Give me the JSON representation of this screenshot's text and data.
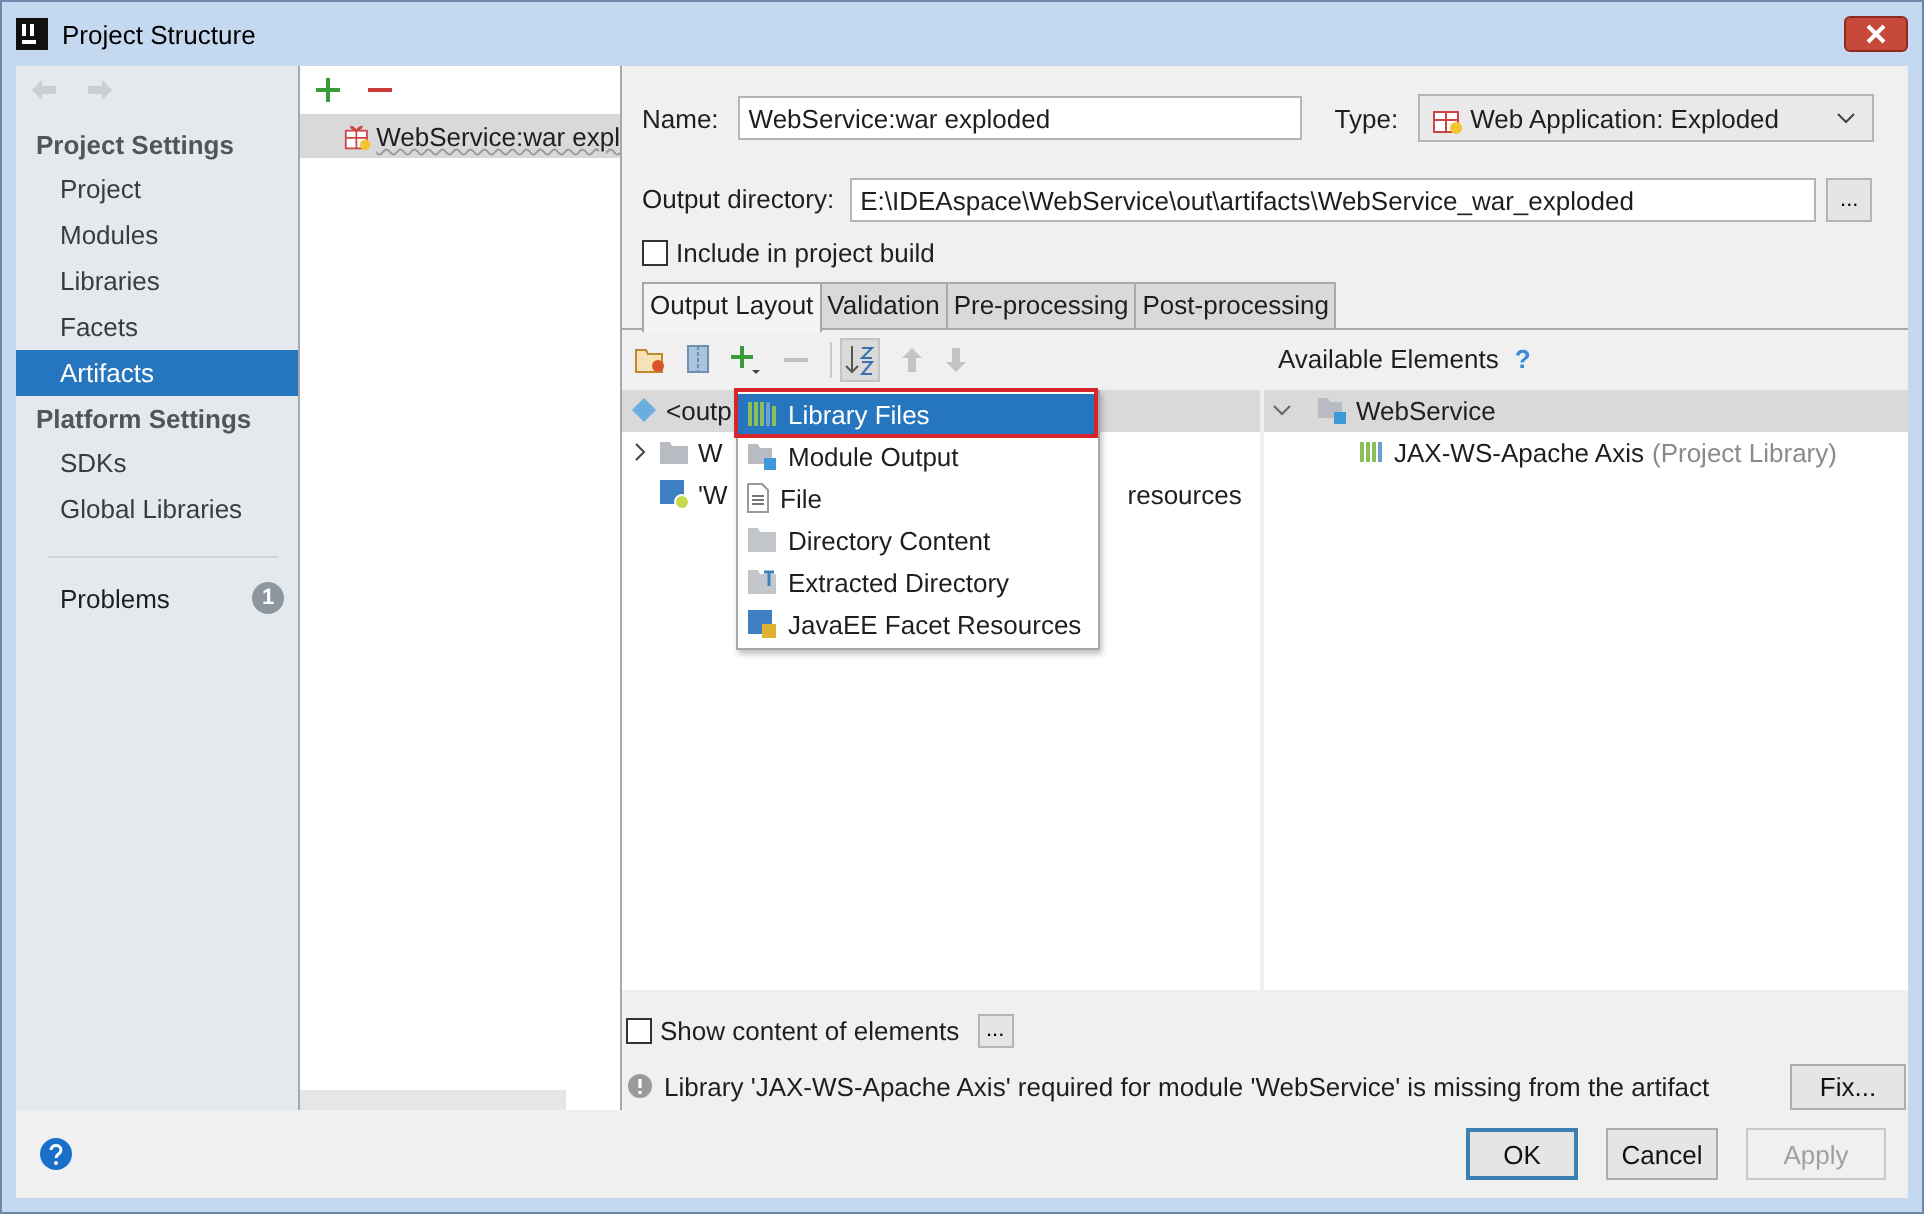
{
  "window": {
    "title": "Project Structure"
  },
  "sidebar": {
    "sections": [
      {
        "heading": "Project Settings",
        "items": [
          {
            "label": "Project",
            "selected": false
          },
          {
            "label": "Modules",
            "selected": false
          },
          {
            "label": "Libraries",
            "selected": false
          },
          {
            "label": "Facets",
            "selected": false
          },
          {
            "label": "Artifacts",
            "selected": true
          }
        ]
      },
      {
        "heading": "Platform Settings",
        "items": [
          {
            "label": "SDKs",
            "selected": false
          },
          {
            "label": "Global Libraries",
            "selected": false
          }
        ]
      }
    ],
    "problems": {
      "label": "Problems",
      "count": "1"
    }
  },
  "artifacts_list": {
    "items": [
      {
        "label": "WebService:war expl",
        "selected": true
      }
    ]
  },
  "name": {
    "label": "Name:",
    "value": "WebService:war exploded"
  },
  "type": {
    "label": "Type:",
    "value": "Web Application: Exploded"
  },
  "output_directory": {
    "label": "Output directory:",
    "value": "E:\\IDEAspace\\WebService\\out\\artifacts\\WebService_war_exploded"
  },
  "browse_button": "...",
  "include_in_build": {
    "label": "Include in project build",
    "checked": false
  },
  "tabs": [
    {
      "label": "Output Layout",
      "selected": true
    },
    {
      "label": "Validation",
      "selected": false
    },
    {
      "label": "Pre-processing",
      "selected": false
    },
    {
      "label": "Post-processing",
      "selected": false
    }
  ],
  "output_tree": {
    "rows": [
      {
        "kind": "root",
        "text": "<outp",
        "selected": true
      },
      {
        "kind": "folder",
        "text": "W",
        "selected": false
      },
      {
        "kind": "resources",
        "text": "'W",
        "trailing": "resources",
        "selected": false
      }
    ]
  },
  "add_menu": {
    "items": [
      {
        "kind": "library",
        "label": "Library Files",
        "selected": true,
        "marked": true
      },
      {
        "kind": "module",
        "label": "Module Output",
        "selected": false,
        "marked": false
      },
      {
        "kind": "file",
        "label": "File",
        "selected": false,
        "marked": false
      },
      {
        "kind": "directory",
        "label": "Directory Content",
        "selected": false,
        "marked": false
      },
      {
        "kind": "extracted",
        "label": "Extracted Directory",
        "selected": false,
        "marked": false
      },
      {
        "kind": "facet",
        "label": "JavaEE Facet Resources",
        "selected": false,
        "marked": false
      }
    ]
  },
  "available_elements": {
    "title": "Available Elements",
    "help": "?",
    "tree": [
      {
        "label": "WebService",
        "expanded": true,
        "selected": true,
        "children": [
          {
            "label": "JAX-WS-Apache Axis",
            "note": "(Project Library)"
          }
        ]
      }
    ]
  },
  "show_content": {
    "label": "Show content of elements",
    "checked": false,
    "button": "..."
  },
  "warning": {
    "text": "Library 'JAX-WS-Apache Axis' required for module 'WebService' is missing from the artifact",
    "button": "Fix..."
  },
  "buttons": [
    {
      "label": "OK",
      "default": true,
      "disabled": false
    },
    {
      "label": "Cancel",
      "default": false,
      "disabled": false
    },
    {
      "label": "Apply",
      "default": false,
      "disabled": true
    }
  ]
}
